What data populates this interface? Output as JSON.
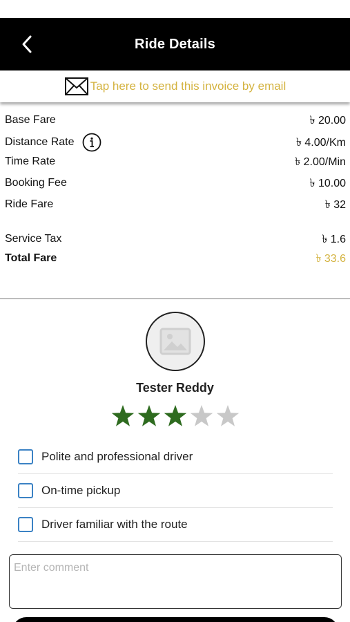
{
  "header": {
    "title": "Ride Details",
    "back_icon": "chevron-left-icon"
  },
  "email_bar": {
    "icon": "envelope-icon",
    "text": "Tap here to send this invoice by email",
    "color": "#d4b340"
  },
  "fares": {
    "rows": [
      {
        "label": "Base Fare",
        "value": "৳ 20.00"
      },
      {
        "label": "Distance Rate",
        "value": "৳ 4.00/Km",
        "info_icon": "info-icon"
      },
      {
        "label": "Time Rate",
        "value": "৳ 2.00/Min"
      },
      {
        "label": "Booking Fee",
        "value": "৳ 10.00"
      },
      {
        "label": "Ride Fare",
        "value": "৳ 32"
      },
      {
        "label": "Service Tax",
        "value": "৳ 1.6"
      }
    ],
    "total": {
      "label": "Total Fare",
      "value": "৳ 33.6"
    }
  },
  "driver": {
    "name": "Tester Reddy",
    "avatar_icon": "image-placeholder-icon",
    "rating": 3,
    "rating_max": 5,
    "star_filled_color": "#2e6b1f",
    "star_empty_color": "#c8c8c8"
  },
  "feedback": {
    "options": [
      {
        "label": "Polite and professional driver",
        "checked": false
      },
      {
        "label": "On-time pickup",
        "checked": false
      },
      {
        "label": "Driver familiar with the route",
        "checked": false
      }
    ],
    "checkbox_color": "#3b82c4"
  },
  "comment": {
    "placeholder": "Enter comment",
    "value": ""
  }
}
